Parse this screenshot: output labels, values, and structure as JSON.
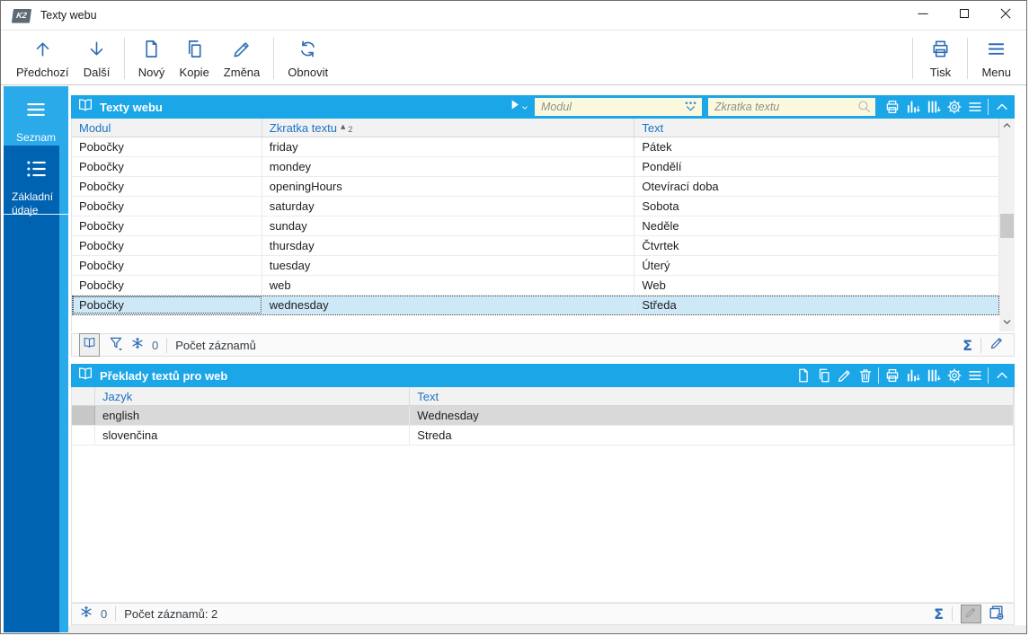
{
  "window": {
    "title": "Texty webu",
    "logo": "K2"
  },
  "colors": {
    "blue": "#1BA6E8",
    "darkblue": "#0063B1",
    "lightblue": "#2BAAEA",
    "accent": "#2F6DB4",
    "sel": "#CDE9F8",
    "cream": "#FBF9DD",
    "colhead": "#1B74C5",
    "graysel": "#D9D9D9"
  },
  "toolbar": {
    "left": [
      {
        "name": "previous-button",
        "label": "Předchozí",
        "icon": "arrow-up"
      },
      {
        "name": "next-button",
        "label": "Další",
        "icon": "arrow-down"
      },
      {
        "sep": true
      },
      {
        "name": "new-button",
        "label": "Nový",
        "icon": "new-doc"
      },
      {
        "name": "copy-button",
        "label": "Kopie",
        "icon": "copy"
      },
      {
        "name": "change-button",
        "label": "Změna",
        "icon": "pencil"
      },
      {
        "sep": true
      },
      {
        "name": "refresh-button",
        "label": "Obnovit",
        "icon": "refresh"
      }
    ],
    "right": [
      {
        "sep": true
      },
      {
        "name": "print-button",
        "label": "Tisk",
        "icon": "printer"
      },
      {
        "sep": true
      },
      {
        "name": "menu-button",
        "label": "Menu",
        "icon": "menu"
      }
    ]
  },
  "sidebar": {
    "items": [
      {
        "name": "seznam",
        "label": "Seznam",
        "icon": "menu",
        "active": true,
        "divider": false
      },
      {
        "name": "zakladni-udaje",
        "label": "Základní údaje",
        "icon": "list-detail",
        "active": false,
        "divider": true
      }
    ]
  },
  "panel1": {
    "title": "Texty webu",
    "filters": [
      {
        "placeholder": "Modul"
      },
      {
        "placeholder": "Zkratka textu"
      }
    ],
    "header_icons": [
      "printer",
      "chart",
      "columns",
      "gear",
      "menu",
      "|",
      "chevron-up"
    ],
    "columns": [
      "Modul",
      "Zkratka textu",
      "Text"
    ],
    "sort": {
      "col": 1,
      "marker": "▲",
      "order": "2"
    },
    "rows": [
      [
        "Pobočky",
        "friday",
        "Pátek"
      ],
      [
        "Pobočky",
        "mondey",
        "Pondělí"
      ],
      [
        "Pobočky",
        "openingHours",
        "Otevírací doba"
      ],
      [
        "Pobočky",
        "saturday",
        "Sobota"
      ],
      [
        "Pobočky",
        "sunday",
        "Neděle"
      ],
      [
        "Pobočky",
        "thursday",
        "Čtvrtek"
      ],
      [
        "Pobočky",
        "tuesday",
        "Úterý"
      ],
      [
        "Pobočky",
        "web",
        "Web"
      ],
      [
        "Pobočky",
        "wednesday",
        "Středa"
      ]
    ],
    "selected_index": 8,
    "status": {
      "count": "0",
      "label": "Počet záznamů",
      "sigma": "Σ"
    }
  },
  "panel2": {
    "title": "Překlady textů pro web",
    "header_icons": [
      "new-doc",
      "copy",
      "pencil",
      "trash",
      "|",
      "printer",
      "chart",
      "columns",
      "gear",
      "menu",
      "|",
      "chevron-up"
    ],
    "columns": [
      "",
      "Jazyk",
      "Text"
    ],
    "rows": [
      [
        "",
        "english",
        "Wednesday"
      ],
      [
        "",
        "slovenčina",
        "Streda"
      ]
    ],
    "selected_index": 0,
    "status": {
      "count": "0",
      "label": "Počet záznamů: 2",
      "sigma": "Σ"
    }
  }
}
